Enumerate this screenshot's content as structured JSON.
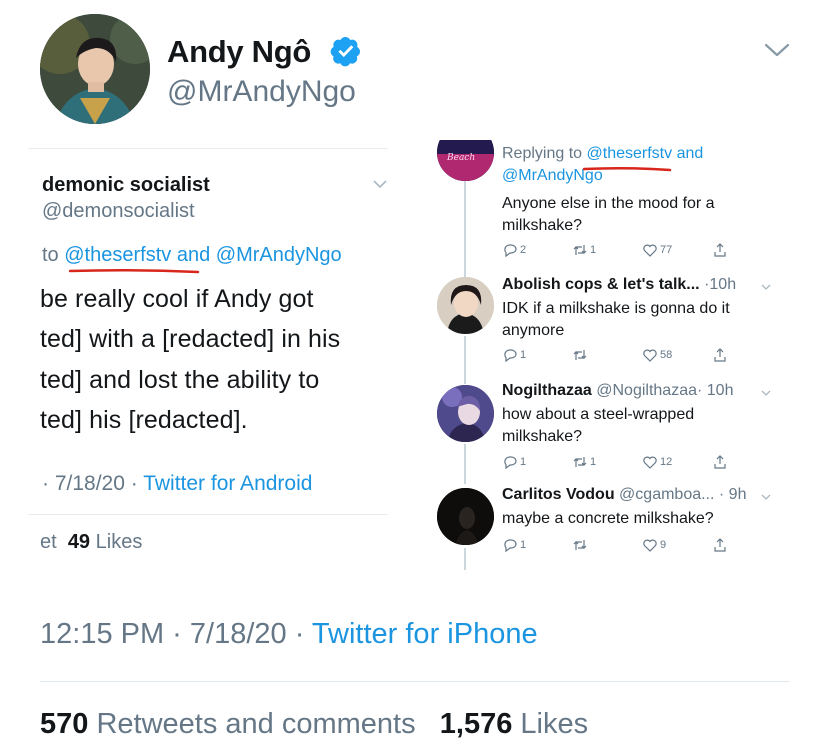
{
  "tweet": {
    "author_name": "Andy Ngô",
    "author_handle": "@MrAndyNgo",
    "timestamp": "12:15 PM · 7/18/20",
    "source": "Twitter for iPhone",
    "retweets_count": "570",
    "retweets_label": "Retweets and comments",
    "likes_count": "1,576",
    "likes_label": "Likes"
  },
  "left_screenshot": {
    "name": "demonic socialist",
    "handle": "@demonsocialist",
    "reply_prefix": "to",
    "reply_user1": "@theserfstv",
    "reply_and": "and",
    "reply_user2": "@MrAndyNgo",
    "body_lines": [
      "be really cool if Andy got",
      "ted] with a [redacted] in his",
      "ted] and lost the ability to",
      "ted] his [redacted]."
    ],
    "meta_date": "· 7/18/20 ·",
    "meta_source": "Twitter for Android",
    "likes_prefix": "et",
    "likes_count": "49",
    "likes_label": "Likes"
  },
  "right_screenshot": {
    "reply_prefix": "Replying to",
    "reply_user1": "@theserfstv",
    "reply_and": "and",
    "reply_user2": "@MrAndyNgo",
    "top_text": "Anyone else in the mood for a milkshake?",
    "top_counts": {
      "reply": "2",
      "retweet": "1",
      "like": "77"
    },
    "replies": [
      {
        "name": "Abolish cops & let's talk...",
        "handle": "",
        "time": "·10h",
        "text": "IDK if a milkshake is gonna do it anymore",
        "reply": "1",
        "retweet": "",
        "like": "58"
      },
      {
        "name": "Nogilthazaa",
        "handle": "@Nogilthazaa",
        "time": "· 10h",
        "text": "how about a steel-wrapped milkshake?",
        "reply": "1",
        "retweet": "1",
        "like": "12"
      },
      {
        "name": "Carlitos Vodou",
        "handle": "@cgamboa...",
        "time": "· 9h",
        "text": "maybe a concrete milkshake?",
        "reply": "1",
        "retweet": "",
        "like": "9"
      }
    ]
  },
  "colors": {
    "link_blue": "#1b95e0",
    "secondary_gray": "#657786",
    "underline_red": "#d9261c",
    "verified_blue": "#1da1f2"
  },
  "icons": [
    "verified-badge-icon",
    "chevron-down-icon",
    "reply-icon",
    "retweet-icon",
    "like-icon",
    "share-icon"
  ]
}
